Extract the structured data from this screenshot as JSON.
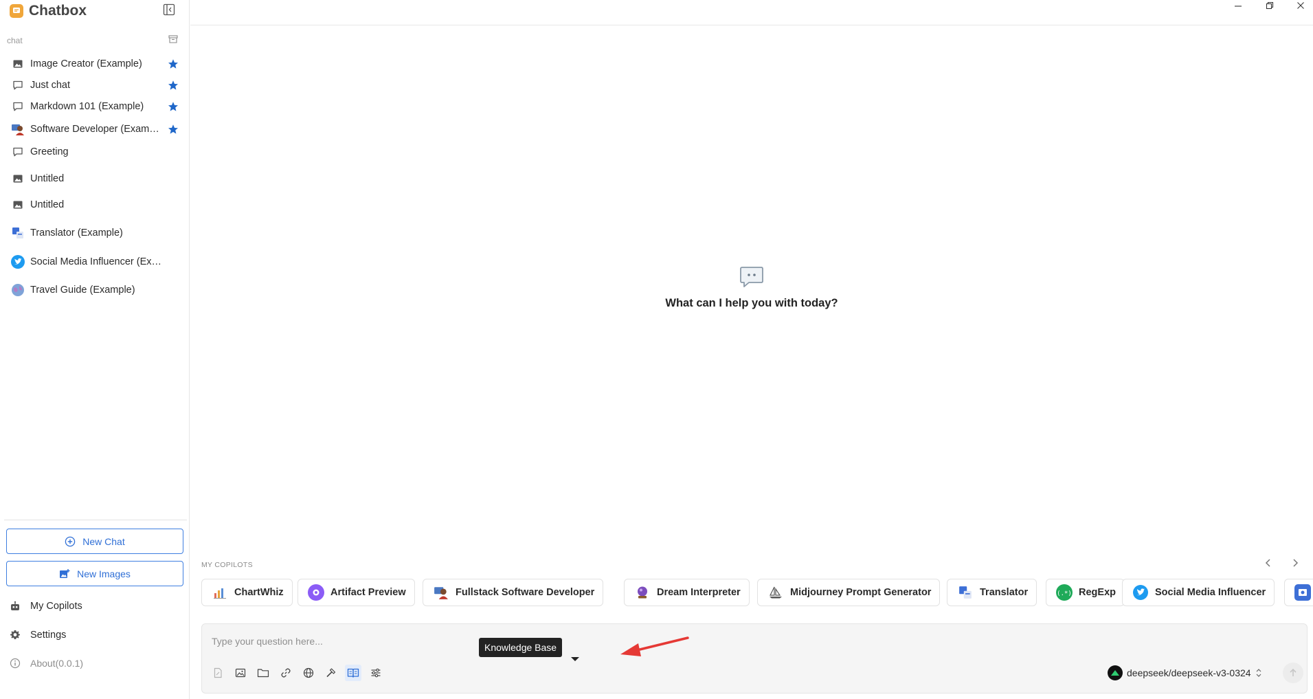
{
  "app": {
    "title": "Chatbox"
  },
  "sidebar": {
    "section_label": "chat",
    "sessions": [
      {
        "label": "Image Creator (Example)",
        "icon": "image-icon",
        "starred": true
      },
      {
        "label": "Just chat",
        "icon": "chat-bubble-icon",
        "starred": true
      },
      {
        "label": "Markdown 101 (Example)",
        "icon": "chat-bubble-icon",
        "starred": true
      },
      {
        "label": "Software Developer (Example)",
        "icon": "developer-avatar-icon",
        "starred": true
      },
      {
        "label": "Greeting",
        "icon": "chat-bubble-icon",
        "starred": false
      },
      {
        "label": "Untitled",
        "icon": "image-icon",
        "starred": false
      },
      {
        "label": "Untitled",
        "icon": "image-icon",
        "starred": false
      },
      {
        "label": "Translator (Example)",
        "icon": "translator-avatar-icon",
        "starred": false
      },
      {
        "label": "Social Media Influencer (Example)",
        "icon": "twitter-avatar-icon",
        "starred": false
      },
      {
        "label": "Travel Guide (Example)",
        "icon": "globe-avatar-icon",
        "starred": false
      }
    ],
    "new_chat_label": "New Chat",
    "new_images_label": "New Images",
    "nav": {
      "copilots_label": "My Copilots",
      "settings_label": "Settings",
      "about_label": "About(0.0.1)"
    }
  },
  "main": {
    "empty_title": "What can I help you with today?",
    "copilots_header": "MY COPILOTS",
    "copilots": [
      {
        "label": "ChartWhiz",
        "icon": "chart-avatar-icon"
      },
      {
        "label": "Artifact Preview",
        "icon": "artifact-avatar-icon"
      },
      {
        "label": "Fullstack Software Developer",
        "icon": "developer-avatar-icon"
      },
      {
        "label": "Dream Interpreter",
        "icon": "crystal-ball-icon"
      },
      {
        "label": "Midjourney Prompt Generator",
        "icon": "sailboat-icon"
      },
      {
        "label": "Translator",
        "icon": "translator-avatar-icon"
      },
      {
        "label": "RegExp",
        "icon": "regexp-avatar-icon"
      },
      {
        "label": "Social Media Influencer",
        "icon": "twitter-avatar-icon"
      }
    ],
    "composer": {
      "placeholder": "Type your question here...",
      "tooltip": "Knowledge Base",
      "model": "deepseek/deepseek-v3-0324"
    }
  },
  "colors": {
    "accent": "#2f6fd6",
    "star": "#1f67c9",
    "annotation": "#e53935",
    "tooltip_bg": "#232323"
  }
}
